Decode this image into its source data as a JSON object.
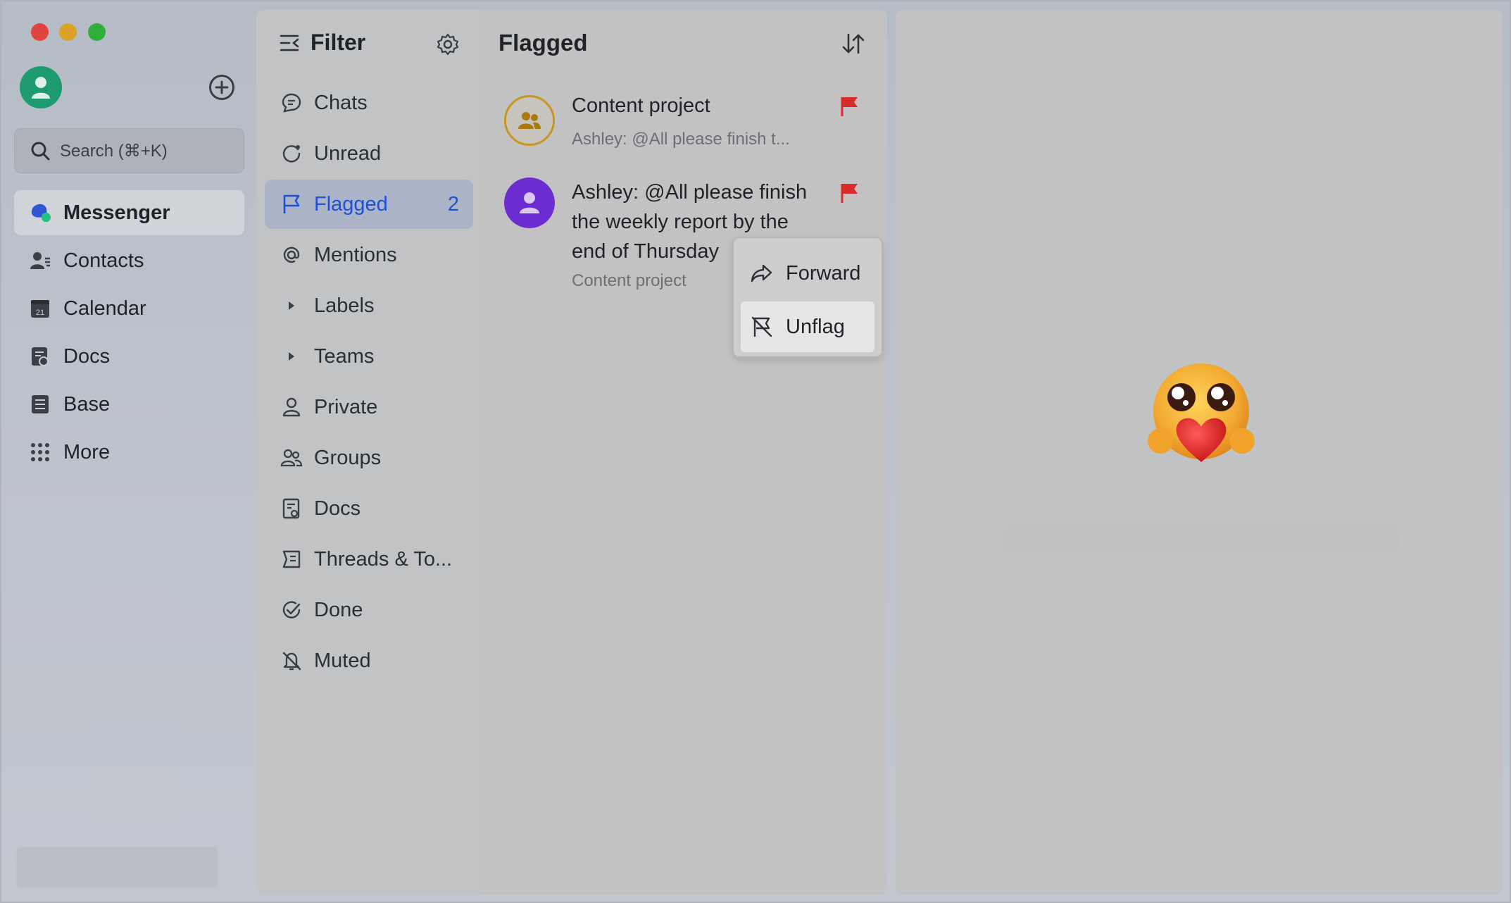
{
  "sidebar": {
    "search_placeholder": "Search (⌘+K)",
    "items": [
      {
        "label": "Messenger",
        "icon": "messenger-icon",
        "active": true
      },
      {
        "label": "Contacts",
        "icon": "contacts-icon"
      },
      {
        "label": "Calendar",
        "icon": "calendar-icon",
        "badge_text": "21"
      },
      {
        "label": "Docs",
        "icon": "docs-icon"
      },
      {
        "label": "Base",
        "icon": "base-icon"
      },
      {
        "label": "More",
        "icon": "more-grid-icon"
      }
    ]
  },
  "filter": {
    "title": "Filter",
    "items": [
      {
        "label": "Chats",
        "icon": "chat-bubble-icon"
      },
      {
        "label": "Unread",
        "icon": "unread-icon"
      },
      {
        "label": "Flagged",
        "icon": "flag-outline-icon",
        "count": "2",
        "active": true
      },
      {
        "label": "Mentions",
        "icon": "at-sign-icon"
      },
      {
        "label": "Labels",
        "icon": "caret-right-icon"
      },
      {
        "label": "Teams",
        "icon": "caret-right-icon"
      },
      {
        "label": "Private",
        "icon": "person-icon"
      },
      {
        "label": "Groups",
        "icon": "group-icon"
      },
      {
        "label": "Docs",
        "icon": "doc-icon"
      },
      {
        "label": "Threads & To...",
        "icon": "threads-icon"
      },
      {
        "label": "Done",
        "icon": "check-circle-icon"
      },
      {
        "label": "Muted",
        "icon": "bell-off-icon"
      }
    ]
  },
  "list": {
    "title": "Flagged",
    "messages": [
      {
        "title": "Content project",
        "subtitle": "Ashley: @All please finish t...",
        "flag_color": "#d92b2b"
      },
      {
        "body": "Ashley: @All  please finish the weekly report by the end of Thursday",
        "subtitle": "Content project",
        "flag_color": "#d92b2b"
      }
    ]
  },
  "context_menu": {
    "items": [
      {
        "label": "Forward",
        "icon": "forward-arrow-icon"
      },
      {
        "label": "Unflag",
        "icon": "unflag-icon",
        "hovered": true
      }
    ]
  },
  "colors": {
    "accent": "#1e4fd8",
    "flag": "#d92b2b",
    "avatar_me": "#1f9b72",
    "group_avatar_ring": "#c8961e",
    "person_avatar": "#6c2ccf"
  }
}
